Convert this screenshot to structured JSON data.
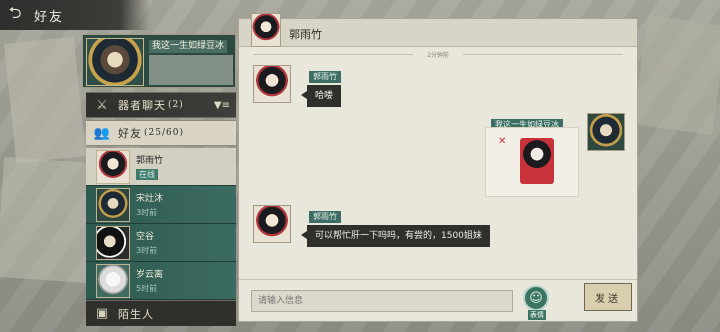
{
  "topbar": {
    "title": "好友",
    "back_icon": "back-arrow-icon"
  },
  "me": {
    "name": "我这一生如绿豆冰"
  },
  "sections": {
    "group_chat": {
      "label": "器者聊天",
      "count": "(2)",
      "icon": "sword-icon"
    },
    "friends": {
      "label": "好友",
      "count": "(25/60)",
      "icon": "people-icon"
    },
    "strangers": {
      "label": "陌生人",
      "icon": "person-card-icon"
    }
  },
  "friends": [
    {
      "name": "郭雨竹",
      "time": "在线",
      "active": true
    },
    {
      "name": "宋灶沐",
      "time": "3时前",
      "active": false
    },
    {
      "name": "空谷",
      "time": "3时前",
      "active": false
    },
    {
      "name": "岁云离",
      "time": "5时前",
      "active": false
    }
  ],
  "chat": {
    "title": "郭雨竹",
    "time_divider": "2分钟前",
    "messages": [
      {
        "sender": "郭雨竹",
        "text": "哈喽",
        "side": "left"
      },
      {
        "sender": "我这一生如绿豆冰",
        "text": "",
        "side": "right",
        "type": "sticker"
      },
      {
        "sender": "郭雨竹",
        "text": "可以帮忙肝一下吗吗，有尝的，1500姐妹",
        "side": "left"
      }
    ],
    "input_placeholder": "请输入信息",
    "emoji_label": "表情",
    "send_label": "发送"
  },
  "colors": {
    "accent_green": "#3c6d62",
    "panel_bg": "#e9e6dc",
    "dark_bubble": "#2f302c"
  }
}
